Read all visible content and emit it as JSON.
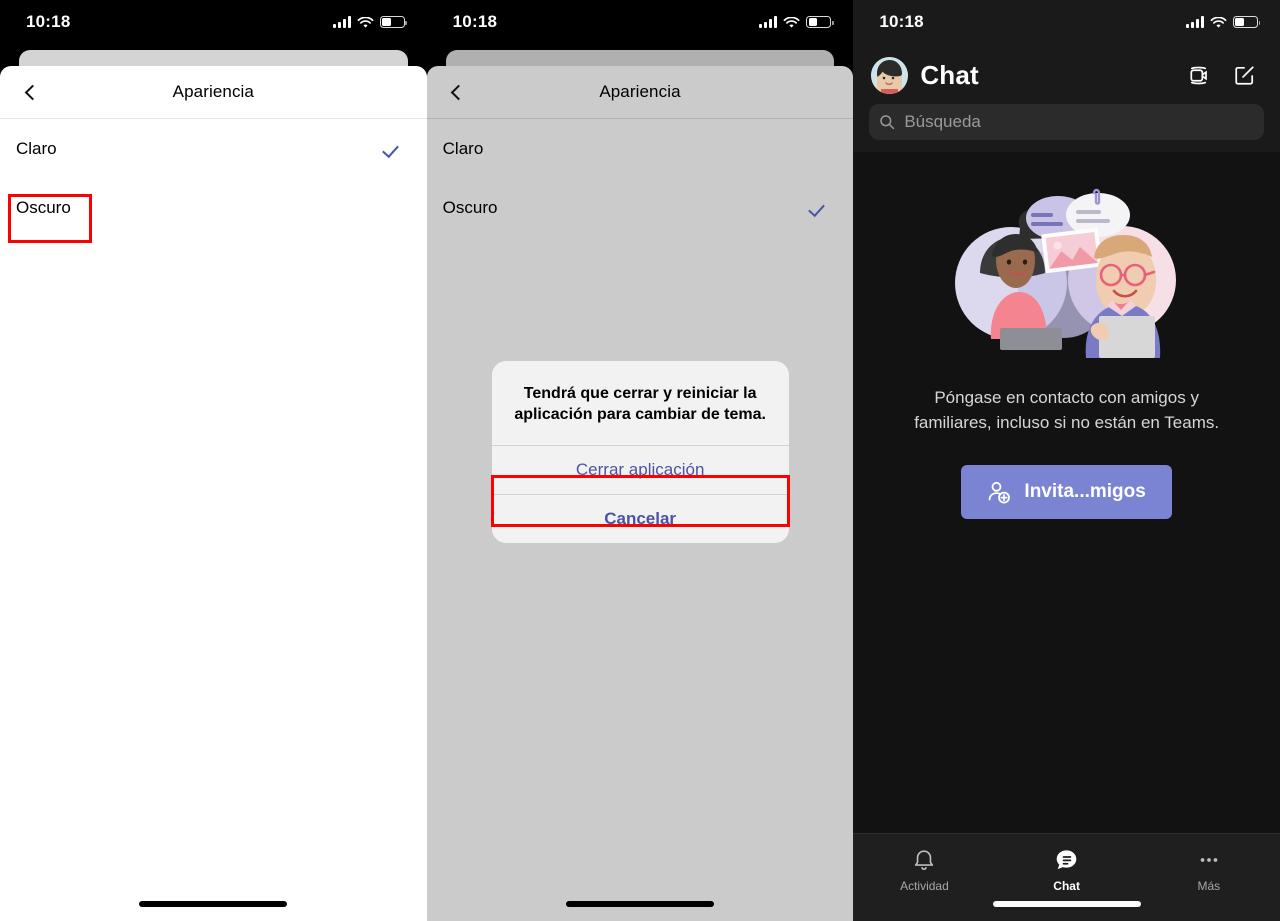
{
  "statusbar": {
    "time": "10:18",
    "signal_icon": "cellular-signal-icon",
    "wifi_icon": "wifi-icon",
    "battery_icon": "battery-icon",
    "battery_level_pct": 42
  },
  "colors": {
    "accent_purple": "#4b53a8",
    "teams_button": "#7b83d3",
    "highlight_red": "#fe0000",
    "sheet_light": "#ffffff",
    "sheet_dimmed": "#cbcbcb",
    "teams_dark_bg": "#121212"
  },
  "panel1": {
    "nav": {
      "back_icon": "chevron-left-icon",
      "title": "Apariencia"
    },
    "options": [
      {
        "label": "Claro",
        "selected": true
      },
      {
        "label": "Oscuro",
        "selected": false
      }
    ],
    "highlight_target": "Oscuro"
  },
  "panel2": {
    "nav": {
      "back_icon": "chevron-left-icon",
      "title": "Apariencia"
    },
    "options": [
      {
        "label": "Claro",
        "selected": false
      },
      {
        "label": "Oscuro",
        "selected": true
      }
    ],
    "alert": {
      "message": "Tendrá que cerrar y reiniciar la aplicación para cambiar de tema.",
      "primary_label": "Cerrar aplicación",
      "secondary_label": "Cancelar",
      "highlight_target": "Cerrar aplicación"
    }
  },
  "panel3": {
    "header": {
      "avatar_icon": "user-avatar",
      "title": "Chat",
      "video_icon": "video-call-icon",
      "compose_icon": "new-chat-compose-icon"
    },
    "search": {
      "icon": "search-icon",
      "placeholder": "Búsqueda",
      "value": ""
    },
    "empty_state": {
      "illustration": "two-people-chatting-illustration",
      "text": "Póngase en contacto con amigos y familiares, incluso si no están en Teams.",
      "button_icon": "add-person-icon",
      "button_label": "Invita...migos"
    },
    "tabbar": [
      {
        "icon": "bell-icon",
        "label": "Actividad",
        "active": false
      },
      {
        "icon": "chat-bubble-icon",
        "label": "Chat",
        "active": true
      },
      {
        "icon": "ellipsis-icon",
        "label": "Más",
        "active": false
      }
    ]
  }
}
